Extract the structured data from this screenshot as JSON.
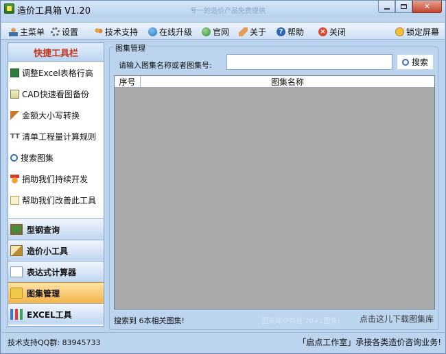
{
  "window": {
    "title": "造价工具箱 V1.20",
    "faint_title": "专一的造价产品免费提供"
  },
  "toolbar": {
    "items": [
      {
        "label": "主菜单",
        "icon": "user-icon"
      },
      {
        "label": "设置",
        "icon": "gear-icon"
      },
      {
        "label": "技术支持",
        "icon": "support-icon"
      },
      {
        "label": "在线升级",
        "icon": "globe-icon"
      },
      {
        "label": "官网",
        "icon": "website-icon"
      },
      {
        "label": "关于",
        "icon": "tag-icon"
      },
      {
        "label": "帮助",
        "icon": "help-icon"
      },
      {
        "label": "关闭",
        "icon": "close-icon"
      }
    ],
    "lock_label": "锁定屏幕"
  },
  "sidebar": {
    "quick_header": "快捷工具栏",
    "quick_items": [
      {
        "label": "调整Excel表格行高",
        "icon": "excel-icon"
      },
      {
        "label": "CAD快速看图备份",
        "icon": "cad-icon"
      },
      {
        "label": "金额大小写转换",
        "icon": "ruler-icon"
      },
      {
        "label": "清单工程量计算规则",
        "icon": "tt-icon"
      },
      {
        "label": "搜索图集",
        "icon": "search-icon"
      },
      {
        "label": "捐助我们持续开发",
        "icon": "medal-icon"
      },
      {
        "label": "帮助我们改善此工具",
        "icon": "note-icon"
      }
    ],
    "nav_items": [
      {
        "label": "型钢查询",
        "icon": "board-icon",
        "active": false
      },
      {
        "label": "造价小工具",
        "icon": "set-square-icon",
        "active": false
      },
      {
        "label": "表达式计算器",
        "icon": "document-icon",
        "active": false
      },
      {
        "label": "图集管理",
        "icon": "folder-icon",
        "active": true
      },
      {
        "label": "EXCEL工具",
        "icon": "bars-icon",
        "active": false
      }
    ]
  },
  "main": {
    "group_title": "图集管理",
    "search_label": "请输入图集名称或者图集号:",
    "search_value": "",
    "search_placeholder": "",
    "search_button": "搜索",
    "columns": [
      "序号",
      "图集名称"
    ],
    "result_count": "搜索到 6本相关图集!",
    "ghost_text": "图集库中共有 70+2图集!",
    "download_link": "点击这儿下载图集库"
  },
  "status": {
    "qq": "技术支持QQ群: 83945733",
    "studio": "「启点工作室」承接各类造价咨询业务!"
  },
  "colors": {
    "accent_header": "#c4381f",
    "active_nav": "#f3b449",
    "grid_bg": "#a9a9a9"
  }
}
